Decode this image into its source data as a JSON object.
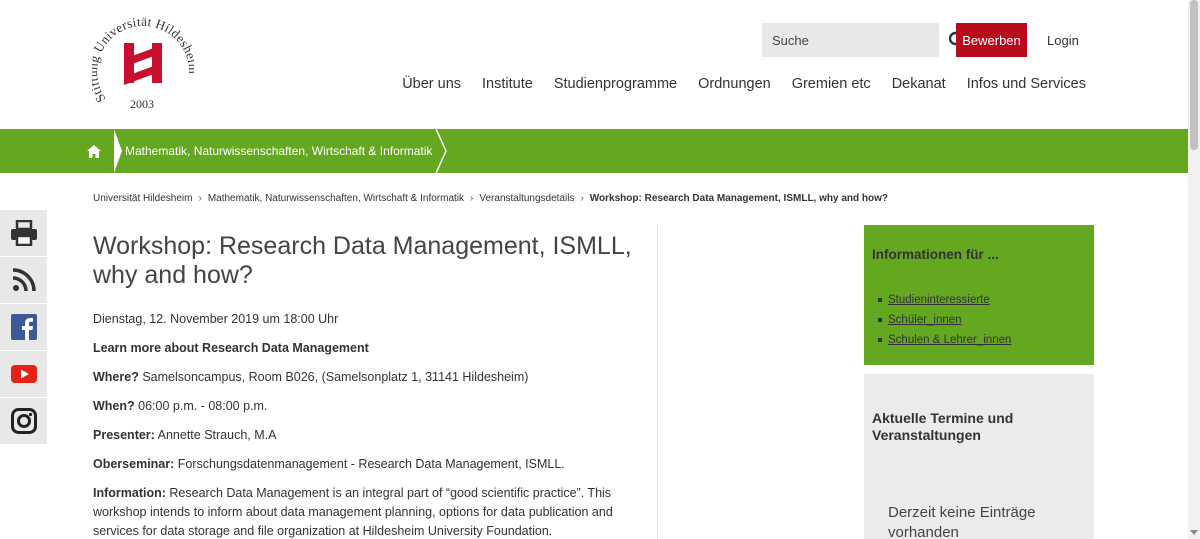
{
  "logo": {
    "arc_text": "Stiftung Universität Hildesheim",
    "year": "2003",
    "brand_color": "#c8102e"
  },
  "header": {
    "search_placeholder": "Suche",
    "apply_label": "Bewerben",
    "login_label": "Login",
    "nav": [
      "Über uns",
      "Institute",
      "Studienprogramme",
      "Ordnungen",
      "Gremien etc",
      "Dekanat",
      "Infos und Services"
    ]
  },
  "green_band": {
    "faculty_label": "Mathematik, Naturwissenschaften, Wirtschaft & Informatik",
    "color": "#64a820"
  },
  "breadcrumb": [
    "Universität Hildesheim",
    "Mathematik, Naturwissenschaften, Wirtschaft & Informatik",
    "Veranstaltungsdetails",
    "Workshop: Research Data Management, ISMLL, why and how?"
  ],
  "social": [
    "print-icon",
    "rss-icon",
    "facebook-icon",
    "youtube-icon",
    "instagram-icon"
  ],
  "content": {
    "title": "Workshop: Research Data Management, ISMLL, why and how?",
    "date": "Dienstag, 12. November 2019 um 18:00 Uhr",
    "intro": "Learn more about Research Data Management",
    "where_label": "Where?",
    "where_value": " Samelsoncampus, Room B026, (Samelsonplatz 1, 31141 Hildesheim)",
    "when_label": "When?",
    "when_value": " 06:00  p.m. - 08:00 p.m.",
    "presenter_label": "Presenter:",
    "presenter_value": " Annette Strauch, M.A",
    "seminar_label": "Oberseminar:",
    "seminar_value": " Forschungsdatenmanagement - Research Data Management, ISMLL.",
    "information_label": "Information:",
    "information_value": " Research Data Management is an integral part of “good scientific practice”. This workshop intends to inform about data management planning, options for data publication and services for data storage and file organization at Hildesheim University Foundation."
  },
  "sidebar": {
    "info_title": "Informationen für ...",
    "info_links": [
      "Studieninteressierte",
      "Schüler_innen",
      "Schulen & Lehrer_innen"
    ],
    "events_title": "Aktuelle Termine und Veranstaltungen",
    "events_empty": "Derzeit keine Einträge vorhanden"
  }
}
